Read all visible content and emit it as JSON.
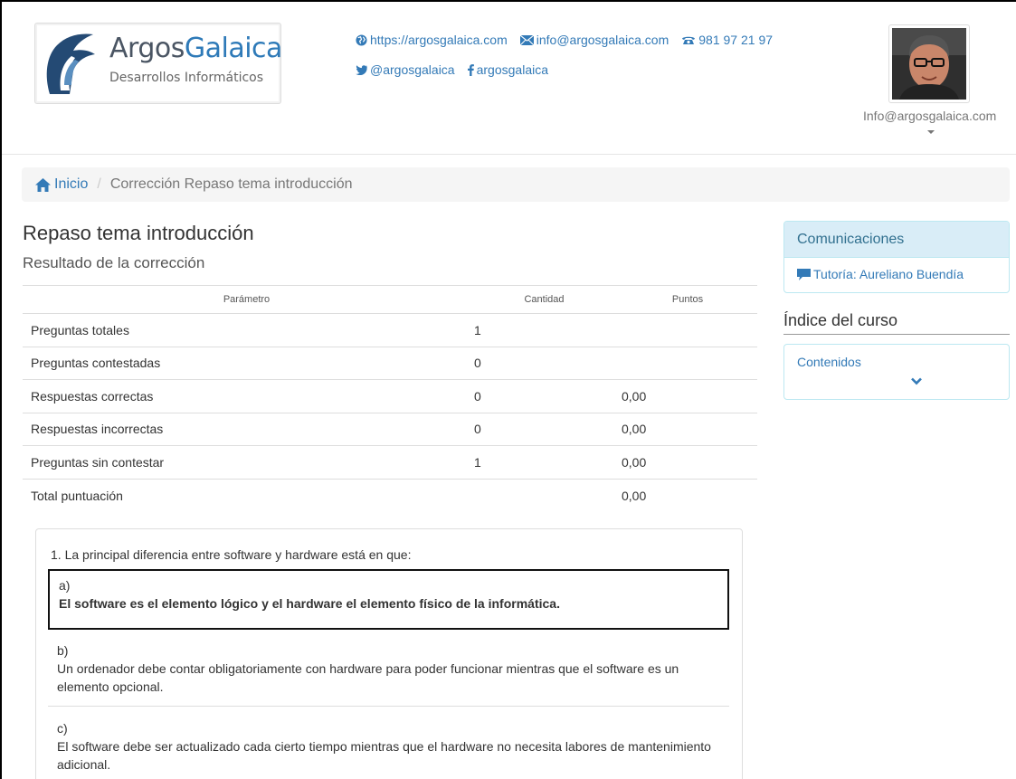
{
  "header": {
    "logo": {
      "word1": "Argos",
      "word2": "Galaica",
      "subtitle": "Desarrollos Informáticos"
    },
    "contacts": {
      "website": "https://argosgalaica.com",
      "email": "info@argosgalaica.com",
      "phone": "981 97 21 97",
      "twitter": "@argosgalaica",
      "facebook": "argosgalaica"
    },
    "user": {
      "email": "Info@argosgalaica.com"
    }
  },
  "breadcrumb": {
    "home": "Inicio",
    "current": "Corrección Repaso tema introducción"
  },
  "main": {
    "title": "Repaso tema introducción",
    "subtitle": "Resultado de la corrección",
    "table": {
      "headers": [
        "Parámetro",
        "Cantidad",
        "Puntos"
      ],
      "rows": [
        [
          "Preguntas totales",
          "1",
          ""
        ],
        [
          "Preguntas contestadas",
          "0",
          ""
        ],
        [
          "Respuestas correctas",
          "0",
          "0,00"
        ],
        [
          "Respuestas incorrectas",
          "0",
          "0,00"
        ],
        [
          "Preguntas sin contestar",
          "1",
          "0,00"
        ],
        [
          "Total puntuación",
          "",
          "0,00"
        ]
      ]
    },
    "question": {
      "text": "1. La principal diferencia entre software y hardware está en que:",
      "options": [
        {
          "letter": "a)",
          "text": "El software es el elemento lógico y el hardware el elemento físico de la informática."
        },
        {
          "letter": "b)",
          "text": "Un ordenador debe contar obligatoriamente con hardware para poder funcionar mientras que el software es un elemento opcional."
        },
        {
          "letter": "c)",
          "text": "El software debe ser actualizado cada cierto tiempo mientras que el hardware no necesita labores de mantenimiento adicional."
        }
      ]
    }
  },
  "sidebar": {
    "communications": {
      "title": "Comunicaciones",
      "tutor_link": "Tutoría: Aureliano Buendía"
    },
    "course_index": {
      "heading": "Índice del curso",
      "contents_label": "Contenidos"
    }
  },
  "colors": {
    "link": "#337ab7",
    "panel_info_bg": "#d9edf7",
    "panel_info_text": "#31708f",
    "logo_blue": "#2e7ab8"
  }
}
